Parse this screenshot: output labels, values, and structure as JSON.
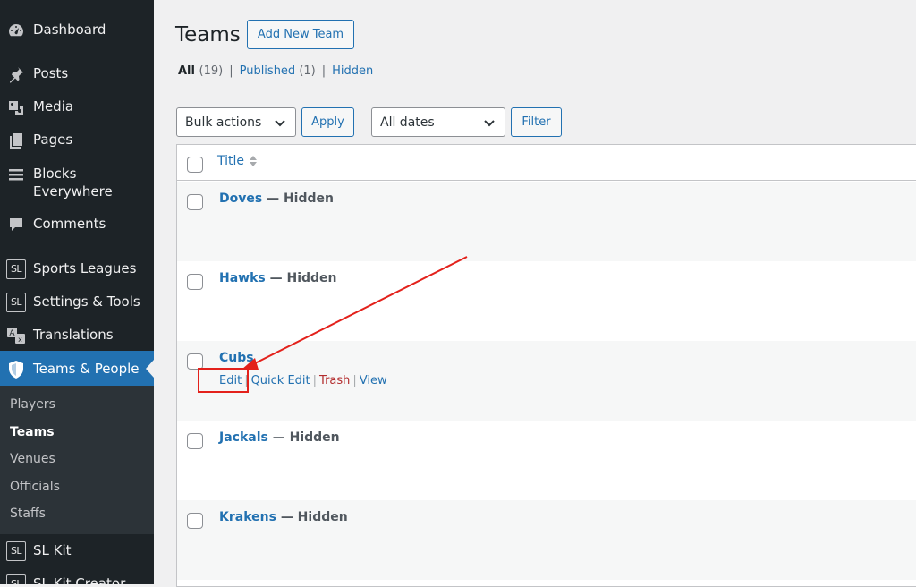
{
  "sidebar": {
    "items": [
      {
        "label": "Dashboard",
        "icon": "dashboard-icon"
      },
      {
        "label": "Posts",
        "icon": "pushpin-icon"
      },
      {
        "label": "Media",
        "icon": "media-icon"
      },
      {
        "label": "Pages",
        "icon": "pages-icon"
      },
      {
        "label": "Blocks Everywhere",
        "icon": "menu-lines-icon"
      },
      {
        "label": "Comments",
        "icon": "comment-icon"
      },
      {
        "label": "Sports Leagues",
        "icon": "sl-icon",
        "badge": "SL"
      },
      {
        "label": "Settings & Tools",
        "icon": "sl-icon",
        "badge": "SL"
      },
      {
        "label": "Translations",
        "icon": "translate-icon"
      },
      {
        "label": "Teams & People",
        "icon": "shield-icon"
      },
      {
        "label": "SL Kit",
        "icon": "sl-icon",
        "badge": "SL"
      },
      {
        "label": "SL Kit Creator",
        "icon": "sl-icon",
        "badge": "SL"
      }
    ],
    "submenu": [
      "Players",
      "Teams",
      "Venues",
      "Officials",
      "Staffs"
    ],
    "active_submenu": "Teams"
  },
  "header": {
    "title": "Teams",
    "add_new_label": "Add New Team"
  },
  "views": {
    "all_label": "All",
    "all_count": "(19)",
    "published_label": "Published",
    "published_count": "(1)",
    "hidden_label": "Hidden",
    "separator": "|"
  },
  "filters": {
    "bulk_actions": "Bulk actions",
    "apply_label": "Apply",
    "dates": "All dates",
    "filter_label": "Filter"
  },
  "table": {
    "column_title": "Title",
    "rows": [
      {
        "name": "Doves",
        "state": "— Hidden"
      },
      {
        "name": "Hawks",
        "state": "— Hidden"
      },
      {
        "name": "Cubs",
        "state": "",
        "actions": [
          "Edit",
          "Quick Edit",
          "Trash",
          "View"
        ]
      },
      {
        "name": "Jackals",
        "state": "— Hidden"
      },
      {
        "name": "Krakens",
        "state": "— Hidden"
      }
    ]
  },
  "colors": {
    "sidebar_bg": "#1d2327",
    "accent": "#2271b1",
    "trash": "#b32d2e",
    "annotation": "#e3211b"
  }
}
